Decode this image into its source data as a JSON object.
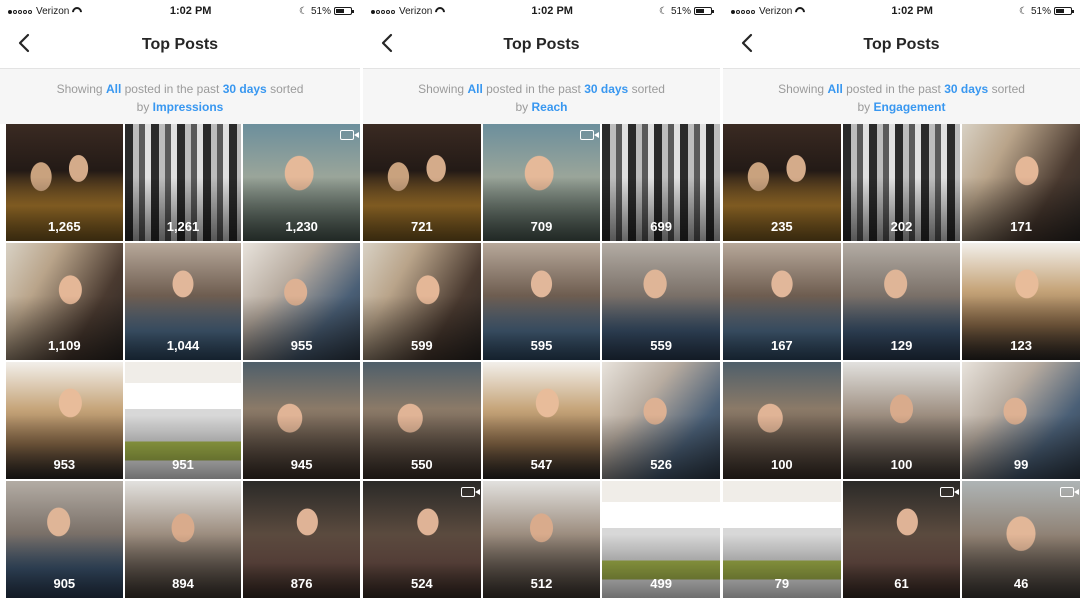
{
  "status_bar": {
    "carrier": "Verizon",
    "time": "1:02 PM",
    "battery": "51%"
  },
  "screens": [
    {
      "title": "Top Posts",
      "info": {
        "prefix": "Showing ",
        "filter": "All",
        "middle": " posted in the past ",
        "period": "30 days",
        "suffix": " sorted",
        "by": "by ",
        "metric": "Impressions"
      },
      "posts": [
        {
          "count": "1,265",
          "photo": "p-couple",
          "video": false
        },
        {
          "count": "1,261",
          "photo": "p-bw",
          "video": false
        },
        {
          "count": "1,230",
          "photo": "p-girl-selfie",
          "video": true
        },
        {
          "count": "1,109",
          "photo": "p-girl-hand",
          "video": false
        },
        {
          "count": "1,044",
          "photo": "p-girl-denim",
          "video": false
        },
        {
          "count": "955",
          "photo": "p-girl-lean",
          "video": false
        },
        {
          "count": "953",
          "photo": "p-girl-blonde",
          "video": false
        },
        {
          "count": "951",
          "photo": "p-web",
          "video": false
        },
        {
          "count": "945",
          "photo": "p-girl-down",
          "video": false
        },
        {
          "count": "905",
          "photo": "p-girl-5in5",
          "video": false
        },
        {
          "count": "894",
          "photo": "p-girl-dark",
          "video": false
        },
        {
          "count": "876",
          "photo": "p-girl-guitar",
          "video": false
        }
      ]
    },
    {
      "title": "Top Posts",
      "info": {
        "prefix": "Showing ",
        "filter": "All",
        "middle": " posted in the past ",
        "period": "30 days",
        "suffix": " sorted",
        "by": "by ",
        "metric": "Reach"
      },
      "posts": [
        {
          "count": "721",
          "photo": "p-couple",
          "video": false
        },
        {
          "count": "709",
          "photo": "p-girl-selfie",
          "video": true
        },
        {
          "count": "699",
          "photo": "p-bw",
          "video": false
        },
        {
          "count": "599",
          "photo": "p-girl-hand",
          "video": false
        },
        {
          "count": "595",
          "photo": "p-girl-denim",
          "video": false
        },
        {
          "count": "559",
          "photo": "p-girl-5in5",
          "video": false
        },
        {
          "count": "550",
          "photo": "p-girl-down",
          "video": false
        },
        {
          "count": "547",
          "photo": "p-girl-blonde",
          "video": false
        },
        {
          "count": "526",
          "photo": "p-girl-lean",
          "video": false
        },
        {
          "count": "524",
          "photo": "p-girl-guitar",
          "video": true
        },
        {
          "count": "512",
          "photo": "p-girl-dark",
          "video": false
        },
        {
          "count": "499",
          "photo": "p-web",
          "video": false
        }
      ]
    },
    {
      "title": "Top Posts",
      "info": {
        "prefix": "Showing ",
        "filter": "All",
        "middle": " posted in the past ",
        "period": "30 days",
        "suffix": " sorted",
        "by": "by ",
        "metric": "Engagement"
      },
      "posts": [
        {
          "count": "235",
          "photo": "p-couple",
          "video": false
        },
        {
          "count": "202",
          "photo": "p-bw",
          "video": false
        },
        {
          "count": "171",
          "photo": "p-girl-hand",
          "video": false
        },
        {
          "count": "167",
          "photo": "p-girl-denim",
          "video": false
        },
        {
          "count": "129",
          "photo": "p-girl-5in5",
          "video": false
        },
        {
          "count": "123",
          "photo": "p-girl-blonde",
          "video": false
        },
        {
          "count": "100",
          "photo": "p-girl-down",
          "video": false
        },
        {
          "count": "100",
          "photo": "p-girl-dark",
          "video": false
        },
        {
          "count": "99",
          "photo": "p-girl-lean",
          "video": false
        },
        {
          "count": "79",
          "photo": "p-web",
          "video": false
        },
        {
          "count": "61",
          "photo": "p-girl-guitar",
          "video": true
        },
        {
          "count": "46",
          "photo": "p-girl-closeup",
          "video": true
        }
      ]
    }
  ]
}
